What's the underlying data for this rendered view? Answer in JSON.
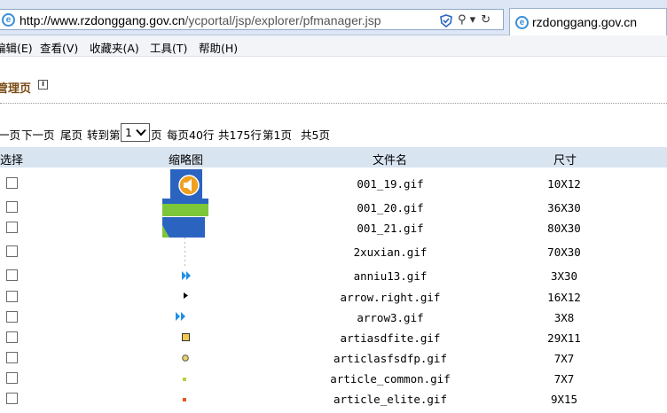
{
  "browser": {
    "url_domain": "http://www.rzdonggang.gov.cn",
    "url_path": "/ycportal/jsp/explorer/pfmanager.jsp",
    "search_glyph": "⚲ ▾",
    "refresh_glyph": "↻",
    "tab_title": "rzdonggang.gov.cn"
  },
  "menu": {
    "edit": "编辑(E)",
    "view": "查看(V)",
    "favorites": "收藏夹(A)",
    "tools": "工具(T)",
    "help": "帮助(H)"
  },
  "page": {
    "title": "管理页",
    "info_glyph": "i"
  },
  "pager": {
    "prev": "一页",
    "next": "下一页",
    "last": "尾页",
    "goto_label": "转到第",
    "selected_page": "1",
    "page_suffix": "页",
    "per_page": "每页40行",
    "total_rows": "共175行",
    "current": "第1页",
    "total_pages": "共5页"
  },
  "table": {
    "headers": {
      "select": "选择",
      "thumb": "缩略图",
      "name": "文件名",
      "size": "尺寸"
    },
    "rows": [
      {
        "name": "001_19.gif",
        "size": "10X12",
        "icon": "speaker-icon"
      },
      {
        "name": "001_20.gif",
        "size": "36X30",
        "icon": "green-bar-icon"
      },
      {
        "name": "001_21.gif",
        "size": "80X30",
        "icon": "blue-green-bar-icon"
      },
      {
        "name": "2xuxian.gif",
        "size": "70X30",
        "icon": "dotted-line-icon"
      },
      {
        "name": "anniu13.gif",
        "size": "3X30",
        "icon": "double-arrow-icon"
      },
      {
        "name": "arrow.right.gif",
        "size": "16X12",
        "icon": "arrow-right-icon"
      },
      {
        "name": "arrow3.gif",
        "size": "3X8",
        "icon": "double-arrow-icon"
      },
      {
        "name": "artiasdfite.gif",
        "size": "29X11",
        "icon": "square-bullet-icon"
      },
      {
        "name": "articlasfsdfp.gif",
        "size": "7X7",
        "icon": "round-bullet-icon"
      },
      {
        "name": "article_common.gif",
        "size": "7X7",
        "icon": "small-square-icon"
      },
      {
        "name": "article_elite.gif",
        "size": "9X15",
        "icon": "small-square-icon"
      }
    ]
  },
  "colors": {
    "title_brown": "#7a4a12",
    "header_bg": "#d9e4f1",
    "arrow_blue": "#1f8fe8",
    "bullet_yellow": "#f2c94c",
    "green": "#7cc63a",
    "blue": "#2a64c0"
  }
}
